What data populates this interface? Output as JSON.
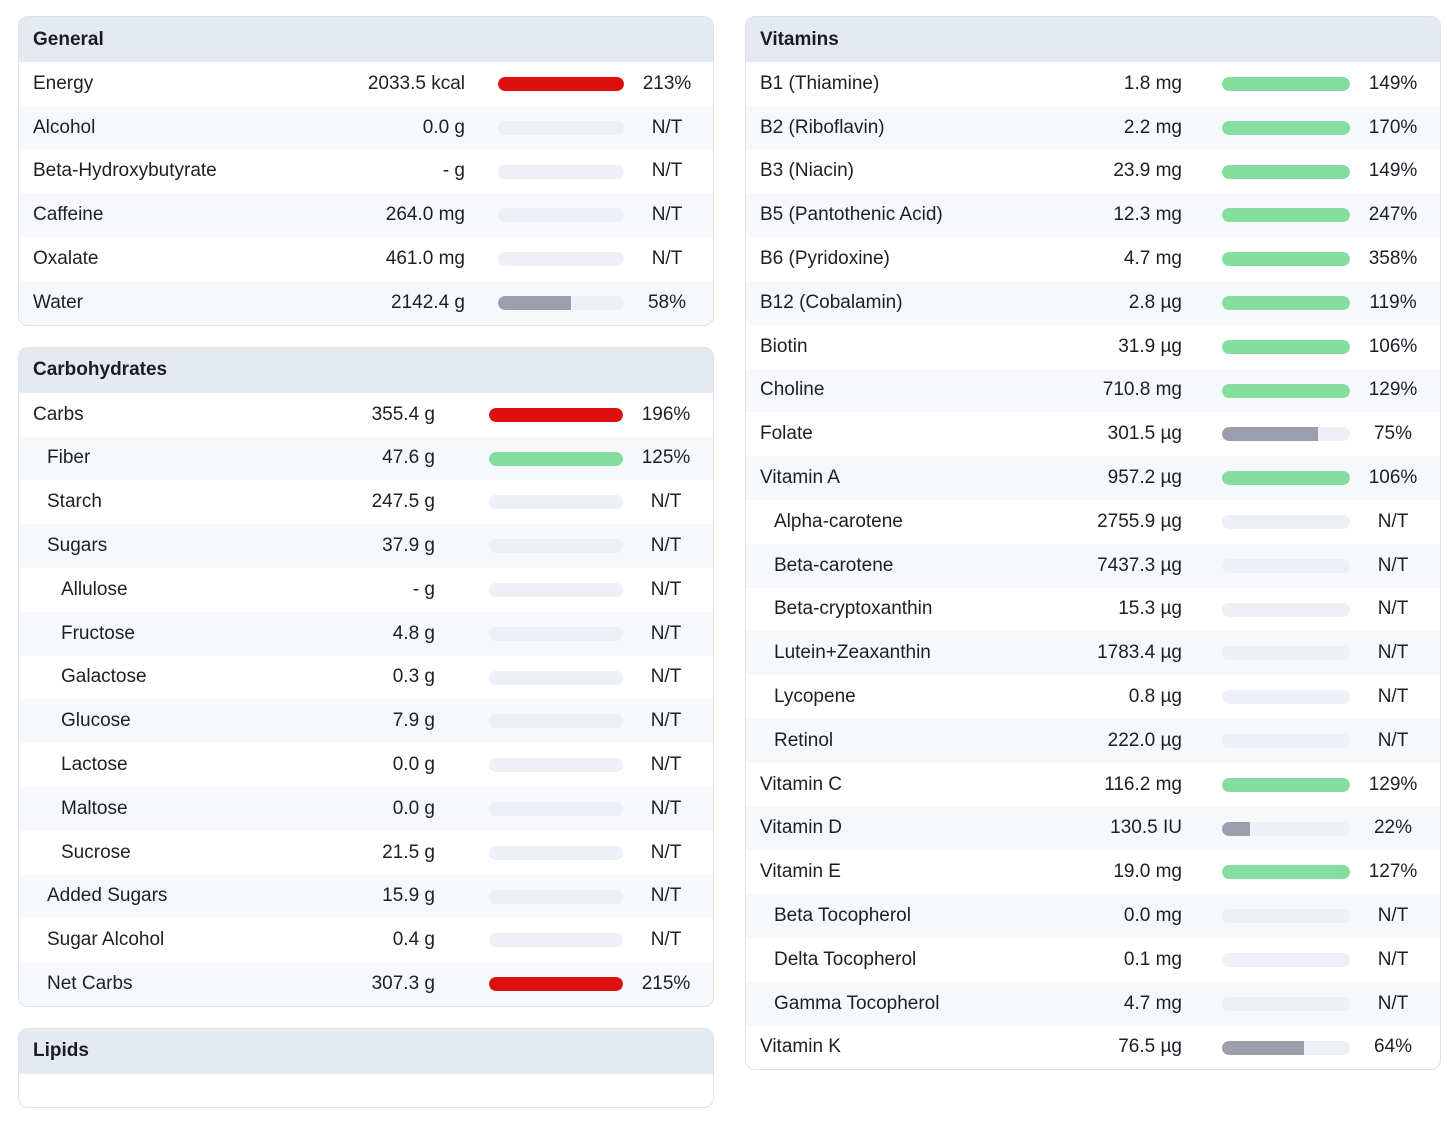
{
  "colors": {
    "over": "#dc0e0e",
    "good": "#84dea0",
    "under": "#9b9fab",
    "track": "#edf1f7"
  },
  "general": {
    "title": "General",
    "rows": [
      {
        "name": "Energy",
        "amount": "2033.5 kcal",
        "pct": "213%",
        "fill": 1.0,
        "status": "over",
        "indent": 0
      },
      {
        "name": "Alcohol",
        "amount": "0.0 g",
        "pct": "N/T",
        "fill": 0,
        "status": "none",
        "indent": 0
      },
      {
        "name": "Beta-Hydroxybutyrate",
        "amount": "- g",
        "pct": "N/T",
        "fill": 0,
        "status": "none",
        "indent": 0
      },
      {
        "name": "Caffeine",
        "amount": "264.0 mg",
        "pct": "N/T",
        "fill": 0,
        "status": "none",
        "indent": 0
      },
      {
        "name": "Oxalate",
        "amount": "461.0 mg",
        "pct": "N/T",
        "fill": 0,
        "status": "none",
        "indent": 0
      },
      {
        "name": "Water",
        "amount": "2142.4 g",
        "pct": "58%",
        "fill": 0.58,
        "status": "under",
        "indent": 0
      }
    ]
  },
  "carbs": {
    "title": "Carbohydrates",
    "rows": [
      {
        "name": "Carbs",
        "amount": "355.4 g",
        "pct": "196%",
        "fill": 1.0,
        "status": "over",
        "indent": 0
      },
      {
        "name": "Fiber",
        "amount": "47.6 g",
        "pct": "125%",
        "fill": 1.0,
        "status": "good",
        "indent": 1
      },
      {
        "name": "Starch",
        "amount": "247.5 g",
        "pct": "N/T",
        "fill": 0,
        "status": "none",
        "indent": 1
      },
      {
        "name": "Sugars",
        "amount": "37.9 g",
        "pct": "N/T",
        "fill": 0,
        "status": "none",
        "indent": 1
      },
      {
        "name": "Allulose",
        "amount": "- g",
        "pct": "N/T",
        "fill": 0,
        "status": "none",
        "indent": 2
      },
      {
        "name": "Fructose",
        "amount": "4.8 g",
        "pct": "N/T",
        "fill": 0,
        "status": "none",
        "indent": 2
      },
      {
        "name": "Galactose",
        "amount": "0.3 g",
        "pct": "N/T",
        "fill": 0,
        "status": "none",
        "indent": 2
      },
      {
        "name": "Glucose",
        "amount": "7.9 g",
        "pct": "N/T",
        "fill": 0,
        "status": "none",
        "indent": 2
      },
      {
        "name": "Lactose",
        "amount": "0.0 g",
        "pct": "N/T",
        "fill": 0,
        "status": "none",
        "indent": 2
      },
      {
        "name": "Maltose",
        "amount": "0.0 g",
        "pct": "N/T",
        "fill": 0,
        "status": "none",
        "indent": 2
      },
      {
        "name": "Sucrose",
        "amount": "21.5 g",
        "pct": "N/T",
        "fill": 0,
        "status": "none",
        "indent": 2
      },
      {
        "name": "Added Sugars",
        "amount": "15.9 g",
        "pct": "N/T",
        "fill": 0,
        "status": "none",
        "indent": 1
      },
      {
        "name": "Sugar Alcohol",
        "amount": "0.4 g",
        "pct": "N/T",
        "fill": 0,
        "status": "none",
        "indent": 1
      },
      {
        "name": "Net Carbs",
        "amount": "307.3 g",
        "pct": "215%",
        "fill": 1.0,
        "status": "over",
        "indent": 1
      }
    ]
  },
  "lipids": {
    "title": "Lipids"
  },
  "vitamins": {
    "title": "Vitamins",
    "rows": [
      {
        "name": "B1 (Thiamine)",
        "amount": "1.8 mg",
        "pct": "149%",
        "fill": 1.0,
        "status": "good",
        "indent": 0
      },
      {
        "name": "B2 (Riboflavin)",
        "amount": "2.2 mg",
        "pct": "170%",
        "fill": 1.0,
        "status": "good",
        "indent": 0
      },
      {
        "name": "B3 (Niacin)",
        "amount": "23.9 mg",
        "pct": "149%",
        "fill": 1.0,
        "status": "good",
        "indent": 0
      },
      {
        "name": "B5 (Pantothenic Acid)",
        "amount": "12.3 mg",
        "pct": "247%",
        "fill": 1.0,
        "status": "good",
        "indent": 0
      },
      {
        "name": "B6 (Pyridoxine)",
        "amount": "4.7 mg",
        "pct": "358%",
        "fill": 1.0,
        "status": "good",
        "indent": 0
      },
      {
        "name": "B12 (Cobalamin)",
        "amount": "2.8 µg",
        "pct": "119%",
        "fill": 1.0,
        "status": "good",
        "indent": 0
      },
      {
        "name": "Biotin",
        "amount": "31.9 µg",
        "pct": "106%",
        "fill": 1.0,
        "status": "good",
        "indent": 0
      },
      {
        "name": "Choline",
        "amount": "710.8 mg",
        "pct": "129%",
        "fill": 1.0,
        "status": "good",
        "indent": 0
      },
      {
        "name": "Folate",
        "amount": "301.5 µg",
        "pct": "75%",
        "fill": 0.75,
        "status": "under",
        "indent": 0
      },
      {
        "name": "Vitamin A",
        "amount": "957.2 µg",
        "pct": "106%",
        "fill": 1.0,
        "status": "good",
        "indent": 0
      },
      {
        "name": "Alpha-carotene",
        "amount": "2755.9 µg",
        "pct": "N/T",
        "fill": 0,
        "status": "none",
        "indent": 1
      },
      {
        "name": "Beta-carotene",
        "amount": "7437.3 µg",
        "pct": "N/T",
        "fill": 0,
        "status": "none",
        "indent": 1
      },
      {
        "name": "Beta-cryptoxanthin",
        "amount": "15.3 µg",
        "pct": "N/T",
        "fill": 0,
        "status": "none",
        "indent": 1
      },
      {
        "name": "Lutein+Zeaxanthin",
        "amount": "1783.4 µg",
        "pct": "N/T",
        "fill": 0,
        "status": "none",
        "indent": 1
      },
      {
        "name": "Lycopene",
        "amount": "0.8 µg",
        "pct": "N/T",
        "fill": 0,
        "status": "none",
        "indent": 1
      },
      {
        "name": "Retinol",
        "amount": "222.0 µg",
        "pct": "N/T",
        "fill": 0,
        "status": "none",
        "indent": 1
      },
      {
        "name": "Vitamin C",
        "amount": "116.2 mg",
        "pct": "129%",
        "fill": 1.0,
        "status": "good",
        "indent": 0
      },
      {
        "name": "Vitamin D",
        "amount": "130.5 IU",
        "pct": "22%",
        "fill": 0.22,
        "status": "under",
        "indent": 0
      },
      {
        "name": "Vitamin E",
        "amount": "19.0 mg",
        "pct": "127%",
        "fill": 1.0,
        "status": "good",
        "indent": 0
      },
      {
        "name": "Beta Tocopherol",
        "amount": "0.0 mg",
        "pct": "N/T",
        "fill": 0,
        "status": "none",
        "indent": 1
      },
      {
        "name": "Delta Tocopherol",
        "amount": "0.1 mg",
        "pct": "N/T",
        "fill": 0,
        "status": "none",
        "indent": 1
      },
      {
        "name": "Gamma Tocopherol",
        "amount": "4.7 mg",
        "pct": "N/T",
        "fill": 0,
        "status": "none",
        "indent": 1
      },
      {
        "name": "Vitamin K",
        "amount": "76.5 µg",
        "pct": "64%",
        "fill": 0.64,
        "status": "under",
        "indent": 0
      }
    ]
  }
}
